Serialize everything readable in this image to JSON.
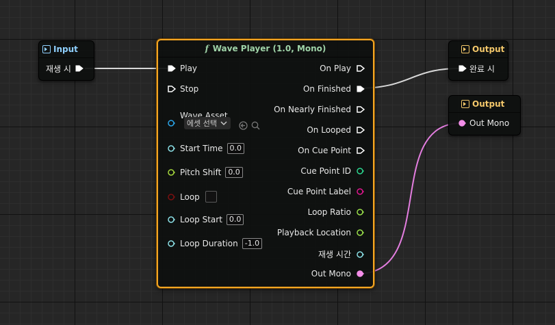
{
  "colors": {
    "exec_pin": "#ffffff",
    "asset_pin": "#2aa4e8",
    "float_pin": "#8be0e6",
    "bool_pin": "#7a1010",
    "pitch_pin": "#a4d63c",
    "int_pin": "#2bd68f",
    "string_pin": "#e0168f",
    "ratio_pin": "#9ae04a",
    "audio_pin": "#f38ee8",
    "selection_border": "#f5a623",
    "audio_wire": "#e47ee0",
    "exec_wire": "#d8d8d8"
  },
  "input_node": {
    "title": "Input",
    "icon": "input-icon",
    "pin_label": "재생 시"
  },
  "wave_player": {
    "title": "Wave Player (1.0, Mono)",
    "icon": "function-icon",
    "inputs": {
      "play": "Play",
      "stop": "Stop",
      "wave_asset": "Wave Asset",
      "asset_picker": "에셋 선택",
      "start_time": "Start Time",
      "start_time_value": "0.0",
      "pitch_shift": "Pitch Shift",
      "pitch_shift_value": "0.0",
      "loop": "Loop",
      "loop_start": "Loop Start",
      "loop_start_value": "0.0",
      "loop_duration": "Loop Duration",
      "loop_duration_value": "-1.0"
    },
    "outputs": {
      "on_play": "On Play",
      "on_finished": "On Finished",
      "on_nearly_finished": "On Nearly Finished",
      "on_looped": "On Looped",
      "on_cue_point": "On Cue Point",
      "cue_point_id": "Cue Point ID",
      "cue_point_label": "Cue Point Label",
      "loop_ratio": "Loop Ratio",
      "playback_location": "Playback Location",
      "playback_time": "재생 시간",
      "out_mono": "Out Mono"
    }
  },
  "output_node_1": {
    "title": "Output",
    "icon": "output-icon",
    "pin_label": "완료 시"
  },
  "output_node_2": {
    "title": "Output",
    "icon": "output-icon",
    "pin_label": "Out Mono"
  }
}
